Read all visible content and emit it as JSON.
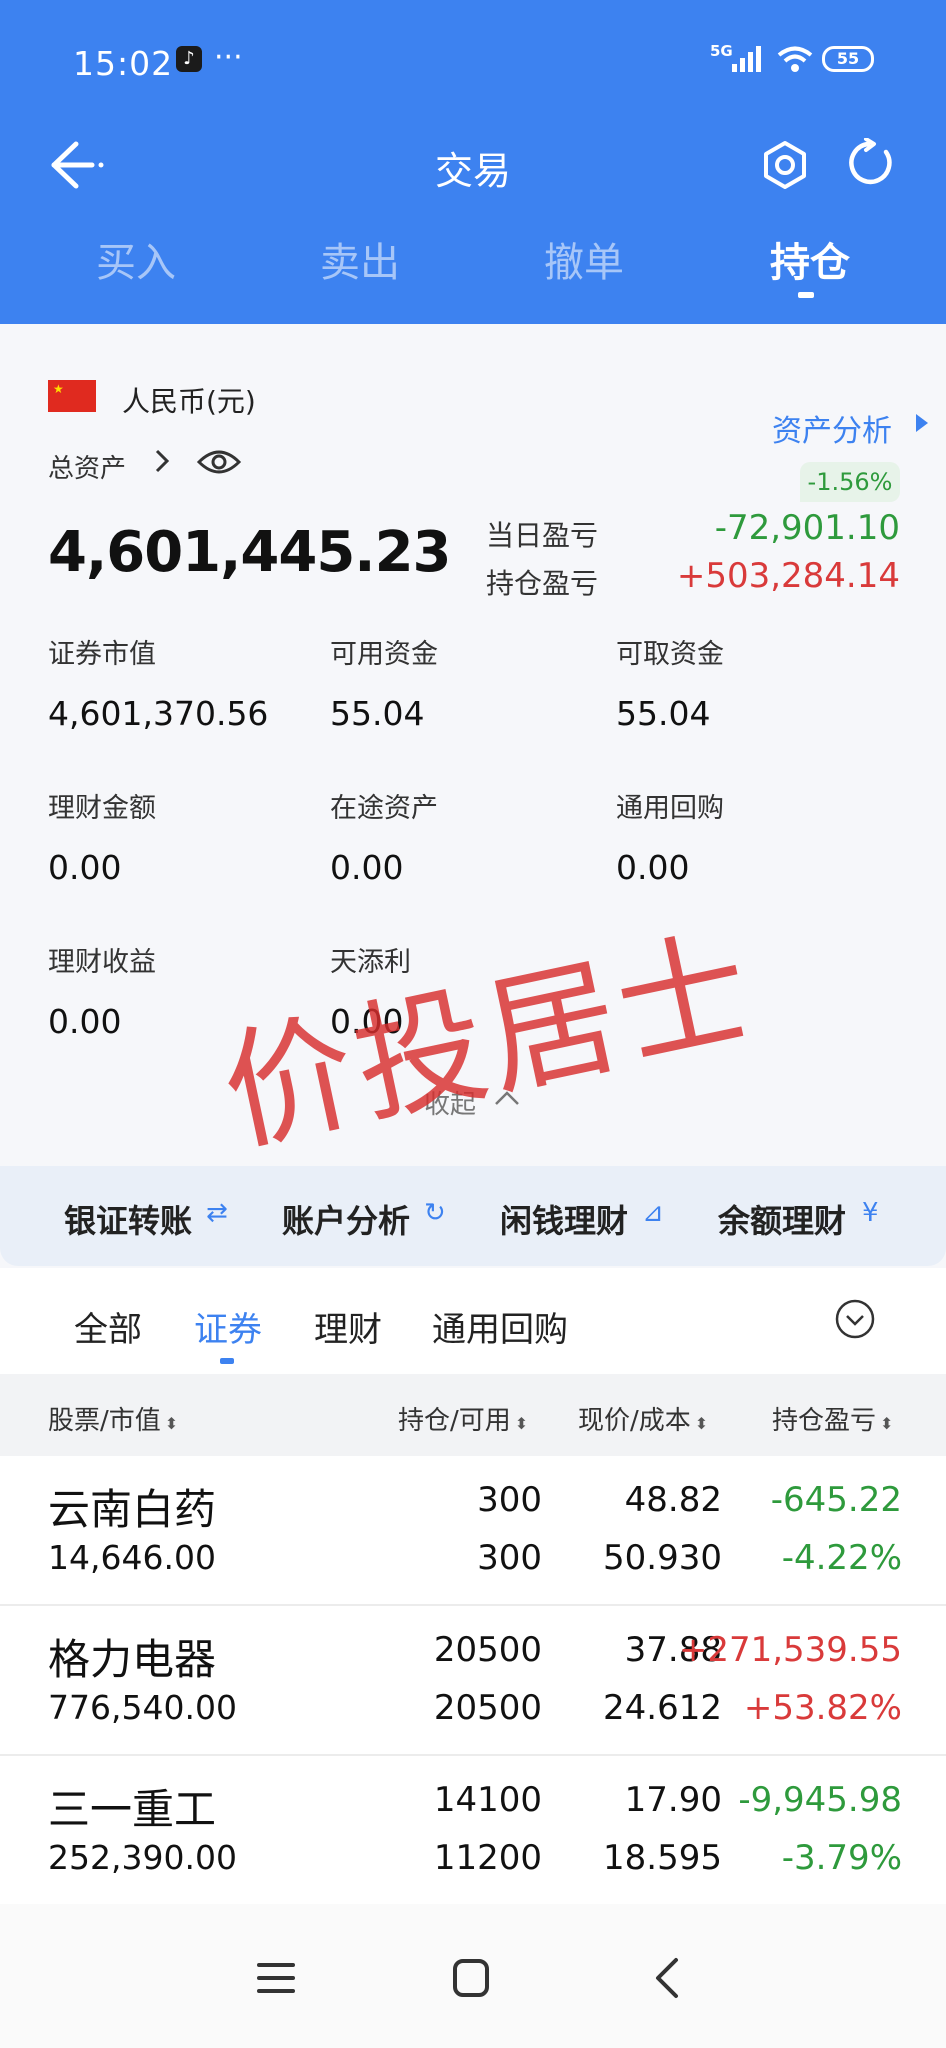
{
  "status": {
    "time": "15:02",
    "network": "5G",
    "battery": "55"
  },
  "nav": {
    "title": "交易"
  },
  "tabs_top": [
    {
      "label": "买入",
      "active": false
    },
    {
      "label": "卖出",
      "active": false
    },
    {
      "label": "撤单",
      "active": false
    },
    {
      "label": "持仓",
      "active": true
    }
  ],
  "account": {
    "currency": "人民币(元)",
    "asset_analysis": "资产分析",
    "total_label": "总资产",
    "total_value": "4,601,445.23",
    "day_change_pct": "-1.56%",
    "day_pl_label": "当日盈亏",
    "day_pl_value": "-72,901.10",
    "hold_pl_label": "持仓盈亏",
    "hold_pl_value": "+503,284.14",
    "metrics": [
      {
        "label": "证券市值",
        "value": "4,601,370.56"
      },
      {
        "label": "可用资金",
        "value": "55.04"
      },
      {
        "label": "可取资金",
        "value": "55.04"
      },
      {
        "label": "理财金额",
        "value": "0.00"
      },
      {
        "label": "在途资产",
        "value": "0.00"
      },
      {
        "label": "通用回购",
        "value": "0.00"
      },
      {
        "label": "理财收益",
        "value": "0.00"
      },
      {
        "label": "天添利",
        "value": "0.00"
      }
    ],
    "watermark": "价投居士",
    "collapse": "收起"
  },
  "quick_actions": [
    {
      "label": "银证转账",
      "icon": "transfer-icon",
      "glyph": "⇄"
    },
    {
      "label": "账户分析",
      "icon": "analysis-icon",
      "glyph": "↻"
    },
    {
      "label": "闲钱理财",
      "icon": "finance-icon",
      "glyph": "⊿"
    },
    {
      "label": "余额理财",
      "icon": "yen-icon",
      "glyph": "¥"
    }
  ],
  "sub_tabs": [
    {
      "label": "全部",
      "active": false
    },
    {
      "label": "证券",
      "active": true
    },
    {
      "label": "理财",
      "active": false
    },
    {
      "label": "通用回购",
      "active": false
    }
  ],
  "table": {
    "headers": [
      "股票/市值",
      "持仓/可用",
      "现价/成本",
      "持仓盈亏"
    ],
    "rows": [
      {
        "name": "云南白药",
        "market_value": "14,646.00",
        "hold": "300",
        "available": "300",
        "price": "48.82",
        "cost": "50.930",
        "pl": "-645.22",
        "pl_pct": "-4.22%",
        "trend": "down"
      },
      {
        "name": "格力电器",
        "market_value": "776,540.00",
        "hold": "20500",
        "available": "20500",
        "price": "37.88",
        "cost": "24.612",
        "pl": "+271,539.55",
        "pl_pct": "+53.82%",
        "trend": "up"
      },
      {
        "name": "三一重工",
        "market_value": "252,390.00",
        "hold": "14100",
        "available": "11200",
        "price": "17.90",
        "cost": "18.595",
        "pl": "-9,945.98",
        "pl_pct": "-3.79%",
        "trend": "down"
      }
    ]
  },
  "colors": {
    "brand": "#3d82f0",
    "gain": "#d93a3a",
    "loss": "#2e9a3c"
  }
}
